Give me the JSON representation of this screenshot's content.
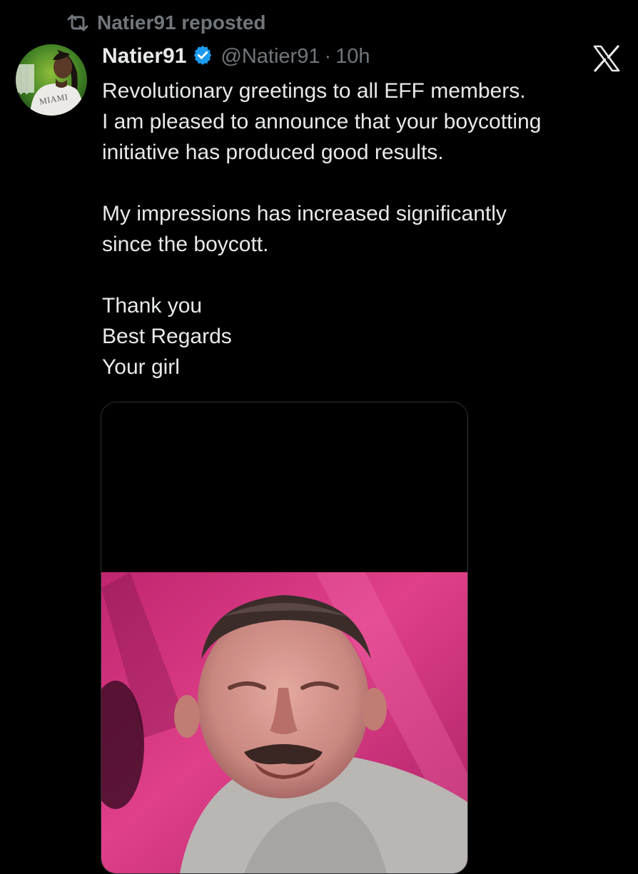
{
  "repost": {
    "icon": "repost-icon",
    "text": "Natier91 reposted"
  },
  "tweet": {
    "display_name": "Natier91",
    "verified_icon": "verified-badge-icon",
    "handle": "@Natier91",
    "separator": "·",
    "time": "10h",
    "avatar_shirt_text": "MIAMI",
    "platform_icon": "x-logo-icon",
    "lines": [
      "Revolutionary greetings to all EFF members.",
      "I am pleased to announce that your boycotting",
      "initiative has produced good results.",
      "",
      "My impressions has increased significantly",
      "since the boycott.",
      "",
      "Thank you",
      "Best Regards",
      "Your girl"
    ]
  },
  "colors": {
    "background": "#000000",
    "text": "#e7e9ea",
    "muted": "#71767b",
    "verified": "#1d9bf0"
  }
}
